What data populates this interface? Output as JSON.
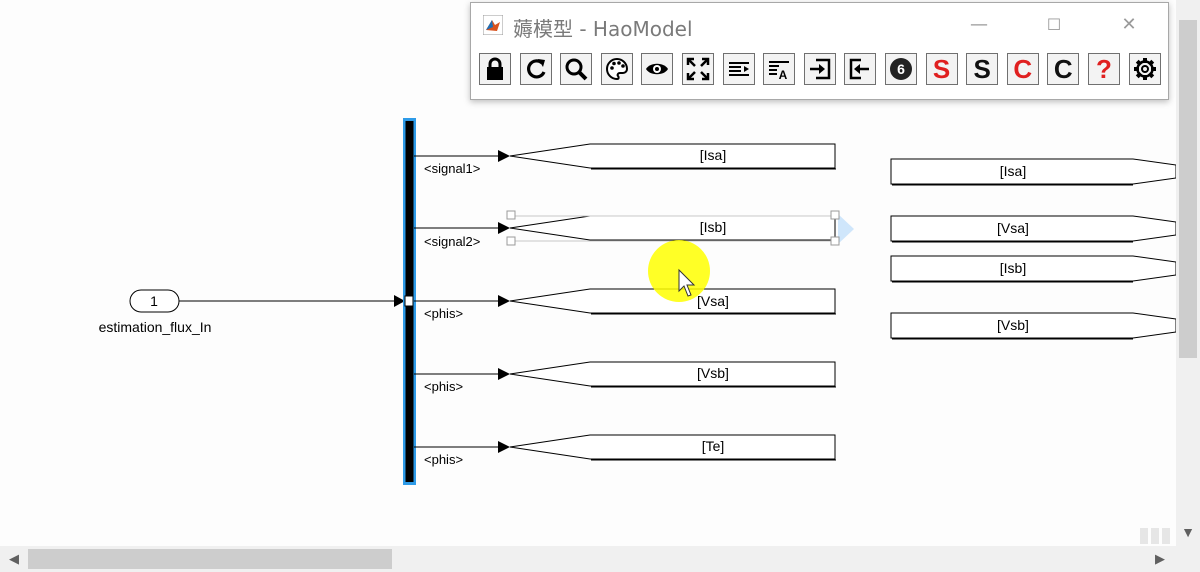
{
  "window": {
    "title": "薅模型 - HaoModel",
    "minimize": "—",
    "maximize": "☐",
    "close": "✕"
  },
  "toolbar": {
    "buttons": [
      {
        "icon": "lock-icon"
      },
      {
        "icon": "refresh-icon"
      },
      {
        "icon": "search-icon"
      },
      {
        "icon": "palette-icon"
      },
      {
        "icon": "eye-icon"
      },
      {
        "icon": "fit-to-view-icon"
      },
      {
        "icon": "align-text-icon"
      },
      {
        "icon": "font-format-icon"
      },
      {
        "icon": "signal-in-icon"
      },
      {
        "icon": "signal-out-icon"
      },
      {
        "icon": "badge-6-icon",
        "text": "6"
      },
      {
        "icon": "s-red-icon",
        "text": "S",
        "color": "#e02020"
      },
      {
        "icon": "s-black-icon",
        "text": "S",
        "color": "#111111"
      },
      {
        "icon": "c-red-icon",
        "text": "C",
        "color": "#e02020"
      },
      {
        "icon": "c-black-icon",
        "text": "C",
        "color": "#111111"
      },
      {
        "icon": "help-icon",
        "text": "?",
        "color": "#e02020"
      },
      {
        "icon": "settings-gear-icon"
      }
    ]
  },
  "model": {
    "inport": {
      "number": "1",
      "name": "estimation_flux_In"
    },
    "bus_outputs": [
      "<signal1>",
      "<signal2>",
      "<phis>",
      "<phis>",
      "<phis>"
    ],
    "goto_tags": [
      "[Isa]",
      "[Isb]",
      "[Vsa]",
      "[Vsb]",
      "[Te]"
    ],
    "from_tags": [
      "[Isa]",
      "[Vsa]",
      "[Isb]",
      "[Vsb]"
    ]
  },
  "colors": {
    "selection": "#2e9be8",
    "cursor_highlight": "#ffff00",
    "bus_bar": "#000000"
  }
}
